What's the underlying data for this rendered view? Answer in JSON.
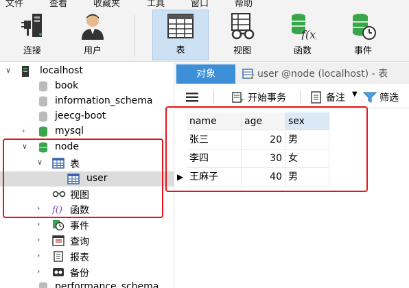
{
  "menu": [
    "文件",
    "查看",
    "收藏夹",
    "工具",
    "窗口",
    "帮助"
  ],
  "toolbar": {
    "connect": "连接",
    "user": "用户",
    "table": "表",
    "view": "视图",
    "function": "函数",
    "event": "事件"
  },
  "tree": {
    "localhost": "localhost",
    "book": "book",
    "information_schema": "information_schema",
    "jeecg_boot": "jeecg-boot",
    "mysql": "mysql",
    "node": "node",
    "tables": "表",
    "user": "user",
    "views": "视图",
    "functions": "函数",
    "events": "事件",
    "queries": "查询",
    "reports": "报表",
    "backups": "备份",
    "performance_schema": "performance_schema"
  },
  "tabs": {
    "objects": "对象",
    "user_tab": "user @node (localhost) - 表"
  },
  "subtoolbar": {
    "begin_transaction": "开始事务",
    "note": "备注",
    "filter": "筛选"
  },
  "table": {
    "columns": [
      "name",
      "age",
      "sex"
    ],
    "rows": [
      {
        "name": "张三",
        "age": "20",
        "sex": "男"
      },
      {
        "name": "李四",
        "age": "30",
        "sex": "女"
      },
      {
        "name": "王麻子",
        "age": "40",
        "sex": "男"
      }
    ]
  },
  "colors": {
    "accent": "#3d8fd8",
    "highlight": "#e8131a",
    "db_green": "#3aa64a"
  }
}
